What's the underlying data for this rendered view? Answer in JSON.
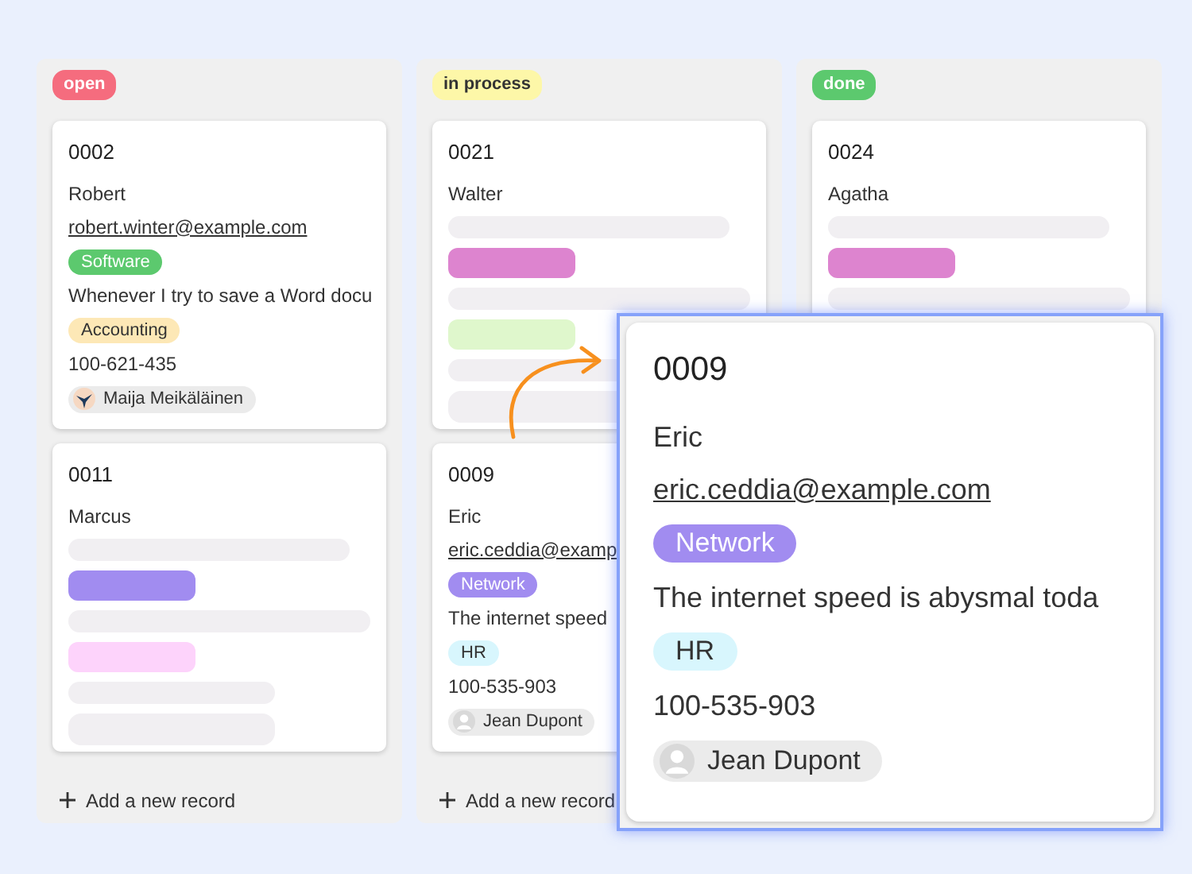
{
  "columns": [
    {
      "status": {
        "text": "open",
        "color": "#f56c7e"
      },
      "cards": [
        {
          "fields": [
            {
              "kind": "title",
              "text": "0002"
            },
            {
              "kind": "text",
              "text": "Robert"
            },
            {
              "kind": "link",
              "text": "robert.winter@example.com"
            },
            {
              "kind": "tag",
              "text": "Software",
              "color": "#5cc96e"
            },
            {
              "kind": "text",
              "text": "Whenever I try to save a Word docu"
            },
            {
              "kind": "tag",
              "text": "Accounting",
              "color": "#fde8b6"
            },
            {
              "kind": "text",
              "text": "100-621-435"
            },
            {
              "kind": "user",
              "text": "Maija Meikäläinen"
            }
          ]
        },
        {
          "fields": [
            {
              "kind": "title",
              "text": "0011"
            },
            {
              "kind": "text",
              "text": "Marcus"
            },
            {
              "kind": "placeholder"
            },
            {
              "kind": "placeholder-tag",
              "color": "#a18cf0"
            },
            {
              "kind": "placeholder",
              "wide": true
            },
            {
              "kind": "placeholder-tag",
              "color": "#fdd3fb"
            },
            {
              "kind": "placeholder",
              "short": true
            },
            {
              "kind": "placeholder",
              "short": true,
              "tall": true
            }
          ]
        }
      ],
      "add_label": "Add a new record"
    },
    {
      "status": {
        "text": "in process",
        "color": "#fdf7a8"
      },
      "cards": [
        {
          "fields": [
            {
              "kind": "title",
              "text": "0021"
            },
            {
              "kind": "text",
              "text": "Walter"
            },
            {
              "kind": "placeholder"
            },
            {
              "kind": "placeholder-tag",
              "color": "#dd84cf"
            },
            {
              "kind": "placeholder",
              "wide": true
            },
            {
              "kind": "placeholder-tag",
              "color": "#dff7cc"
            },
            {
              "kind": "placeholder",
              "wide": true
            },
            {
              "kind": "placeholder",
              "wide": true,
              "tall": true
            }
          ]
        },
        {
          "fields": [
            {
              "kind": "title",
              "text": "0009"
            },
            {
              "kind": "text",
              "text": "Eric"
            },
            {
              "kind": "link",
              "text": "eric.ceddia@examp"
            },
            {
              "kind": "tag",
              "text": "Network",
              "color": "#a18cf0"
            },
            {
              "kind": "text",
              "text": "The internet speed"
            },
            {
              "kind": "tag",
              "text": "HR",
              "color": "#d8f6fd"
            },
            {
              "kind": "text",
              "text": "100-535-903"
            },
            {
              "kind": "user",
              "text": "Jean Dupont",
              "avatar": {
                "kind": "person"
              }
            }
          ]
        }
      ],
      "add_label": "Add a new record"
    },
    {
      "status": {
        "text": "done",
        "color": "#5cc96e"
      },
      "cards": [
        {
          "fields": [
            {
              "kind": "title",
              "text": "0024"
            },
            {
              "kind": "text",
              "text": "Agatha"
            },
            {
              "kind": "placeholder"
            },
            {
              "kind": "placeholder-tag",
              "color": "#dd84cf"
            },
            {
              "kind": "placeholder",
              "wide": true
            }
          ]
        }
      ]
    }
  ],
  "zoomed_card": {
    "fields": [
      {
        "kind": "title",
        "text": "0009"
      },
      {
        "kind": "text",
        "text": "Eric"
      },
      {
        "kind": "link",
        "text": "eric.ceddia@example.com"
      },
      {
        "kind": "tag",
        "text": "Network",
        "color": "#a18cf0"
      },
      {
        "kind": "text",
        "text": "The internet speed is abysmal toda"
      },
      {
        "kind": "tag",
        "text": "HR",
        "color": "#d8f6fd"
      },
      {
        "kind": "text",
        "text": "100-535-903"
      },
      {
        "kind": "user",
        "text": "Jean Dupont",
        "avatar": {
          "kind": "person"
        }
      }
    ]
  }
}
